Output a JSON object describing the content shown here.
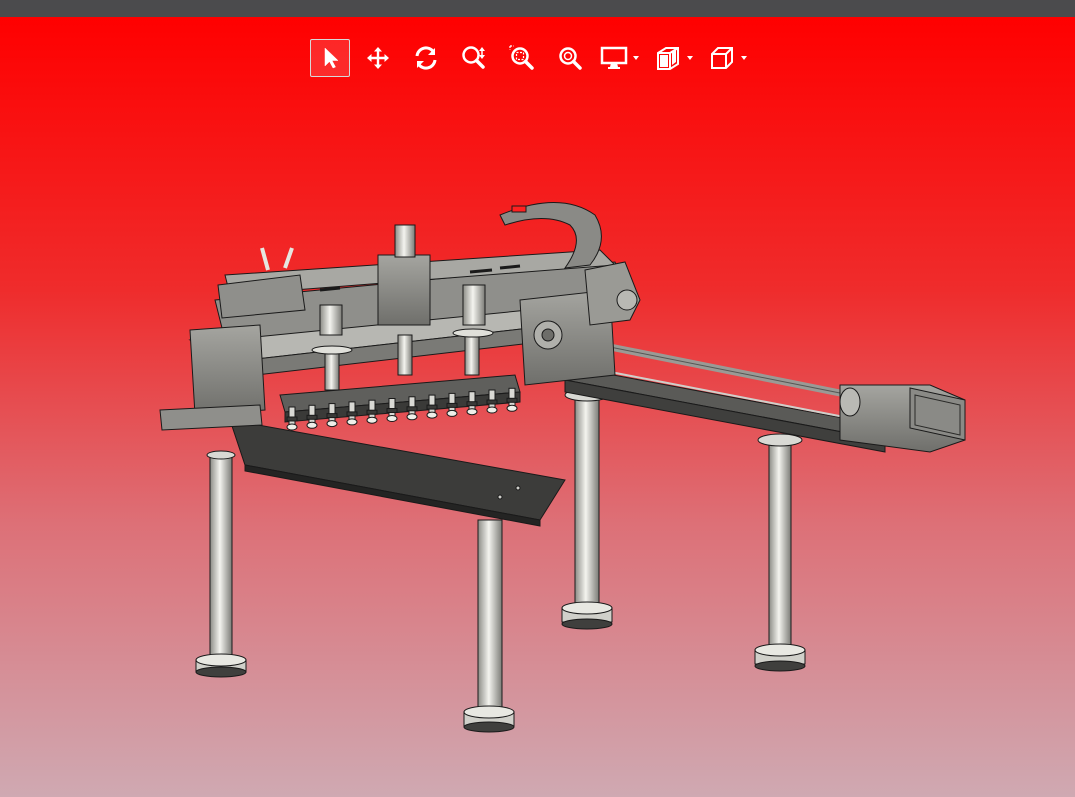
{
  "colors": {
    "topbar": "#4b4b4d",
    "background_top": "#ff0000",
    "background_bottom": "#cfa9b2",
    "toolbar_icon": "#ffffff",
    "active_border": "#d8d8d8",
    "model_body": "#8f8f8b",
    "model_dark": "#3f3f3d",
    "model_light": "#d9d9d4",
    "model_edge": "#1a1a1a"
  },
  "toolbar": {
    "buttons": [
      {
        "id": "select",
        "icon": "cursor-arrow-icon",
        "active": true
      },
      {
        "id": "pan",
        "icon": "move-arrows-icon",
        "active": false
      },
      {
        "id": "rotate",
        "icon": "rotate-icon",
        "active": false
      },
      {
        "id": "zoom",
        "icon": "zoom-updown-icon",
        "active": false
      },
      {
        "id": "zoom-window",
        "icon": "zoom-window-icon",
        "active": false
      },
      {
        "id": "zoom-fit",
        "icon": "zoom-fit-icon",
        "active": false
      }
    ],
    "dropdowns": [
      {
        "id": "display-mode",
        "icon": "monitor-icon"
      },
      {
        "id": "section-view",
        "icon": "section-view-icon"
      },
      {
        "id": "standard-views",
        "icon": "cube-view-icon"
      }
    ]
  },
  "scene": {
    "description_icon": "cad-assembly-model",
    "model": "gantry-pick-and-place-assembly"
  }
}
